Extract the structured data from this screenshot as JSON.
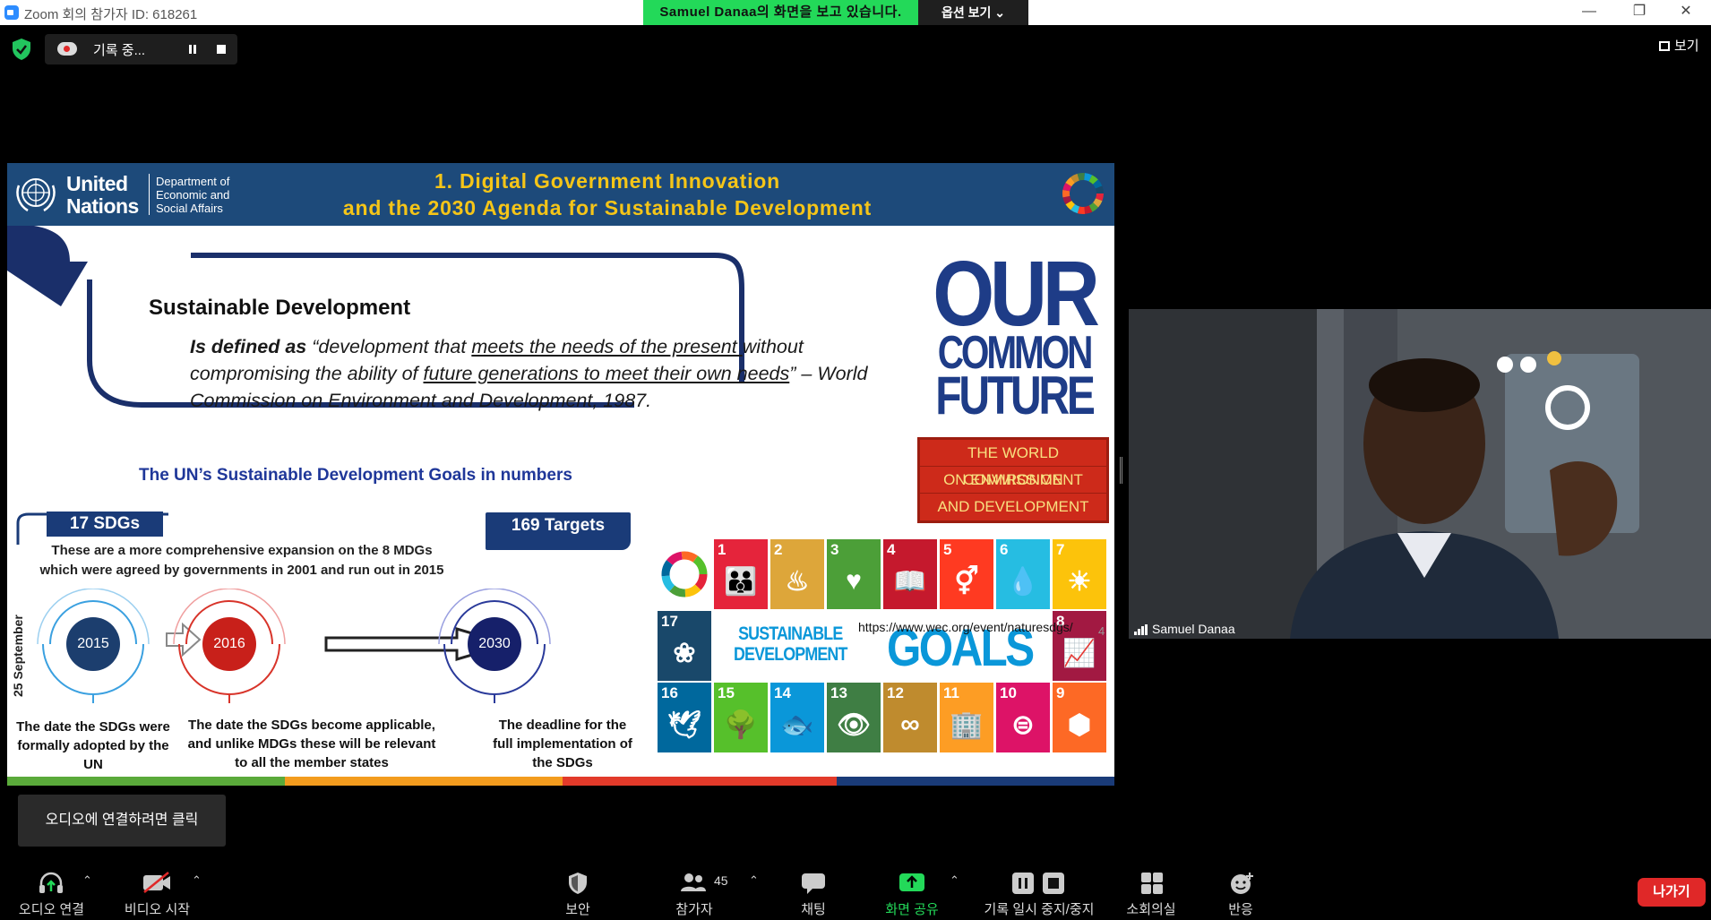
{
  "window": {
    "title": "Zoom 회의 참가자 ID: 618261"
  },
  "share_banner": {
    "text": "Samuel  Danaa의 화면을 보고 있습니다.",
    "view_options": "옵션 보기 ⌄"
  },
  "recording": {
    "label": "기록 중..."
  },
  "view_button": {
    "label": "보기"
  },
  "slide": {
    "un_name_1": "United",
    "un_name_2": "Nations",
    "dept_1": "Department of",
    "dept_2": "Economic and",
    "dept_3": "Social Affairs",
    "title_1": "1. Digital Government Innovation",
    "title_2": "and the 2030 Agenda for Sustainable Development",
    "sd_heading": "Sustainable Development",
    "sd_def_bold": "Is defined as",
    "sd_def_1": " “development that ",
    "sd_def_u1": "meets the needs of the present ",
    "sd_def_2": "without compromising the ability of ",
    "sd_def_u2": "future generations to meet their own needs",
    "sd_def_3": "” – World Commission on Environment and Development, 1987.",
    "numbers_heading": "The UN’s Sustainable Development Goals in numbers",
    "book": {
      "our": "OUR",
      "common": "COMMON",
      "future": "FUTURE",
      "wcb_1": "THE WORLD COMMISSION",
      "wcb_2": "ON ENVIRONMENT",
      "wcb_3": "AND DEVELOPMENT"
    },
    "tag_sdgs": "17 SDGs",
    "tag_sdgs_note": "These are a more comprehensive expansion on the 8 MDGs which were agreed by governments in 2001 and run out in 2015",
    "tag_targets": "169 Targets",
    "side_date": "25 September",
    "year_1": "2015",
    "year_2": "2016",
    "year_3": "2030",
    "caption_1": "The date the SDGs were formally adopted by the UN",
    "caption_2": "The date the SDGs become applicable, and unlike MDGs these will be relevant to all the member states",
    "caption_3": "The deadline for the full implementation of the SDGs",
    "sdg_banner_1": "SUSTAINABLE",
    "sdg_banner_2": "DEVELOPMENT",
    "sdg_goals": "GOALS",
    "url": "https://www.wec.org/event/naturesdgs/",
    "page": "4"
  },
  "sdg_tiles": [
    {
      "n": "1",
      "color": "#e5243b",
      "sym": "👪"
    },
    {
      "n": "2",
      "color": "#dda63a",
      "sym": "♨"
    },
    {
      "n": "3",
      "color": "#4c9f38",
      "sym": "♥"
    },
    {
      "n": "4",
      "color": "#c5192d",
      "sym": "📖"
    },
    {
      "n": "5",
      "color": "#ff3a21",
      "sym": "⚥"
    },
    {
      "n": "6",
      "color": "#26bde2",
      "sym": "💧"
    },
    {
      "n": "7",
      "color": "#fcc30b",
      "sym": "☀"
    },
    {
      "n": "17",
      "color": "#19486a",
      "sym": "❀"
    },
    {
      "n": "8",
      "color": "#a21942",
      "sym": "📈"
    },
    {
      "n": "16",
      "color": "#00689d",
      "sym": "🕊"
    },
    {
      "n": "15",
      "color": "#56c02b",
      "sym": "🌳"
    },
    {
      "n": "14",
      "color": "#0a97d9",
      "sym": "🐟"
    },
    {
      "n": "13",
      "color": "#3f7e44",
      "sym": "👁"
    },
    {
      "n": "12",
      "color": "#bf8b2e",
      "sym": "∞"
    },
    {
      "n": "11",
      "color": "#fd9d24",
      "sym": "🏢"
    },
    {
      "n": "10",
      "color": "#dd1367",
      "sym": "⊜"
    },
    {
      "n": "9",
      "color": "#fd6925",
      "sym": "⬢"
    }
  ],
  "video": {
    "name": "Samuel Danaa"
  },
  "audio_tip": "오디오에 연결하려면 클릭",
  "toolbar": {
    "audio": "오디오 연결",
    "video": "비디오 시작",
    "security": "보안",
    "participants": "참가자",
    "participant_count": "45",
    "chat": "채팅",
    "share": "화면 공유",
    "record": "기록 일시 중지/중지",
    "breakout": "소회의실",
    "reactions": "반응",
    "leave": "나가기"
  },
  "colors": {
    "share_green": "#23d959",
    "un_blue": "#1d4a7a",
    "leave_red": "#e02828",
    "title_gold": "#f5c518"
  }
}
